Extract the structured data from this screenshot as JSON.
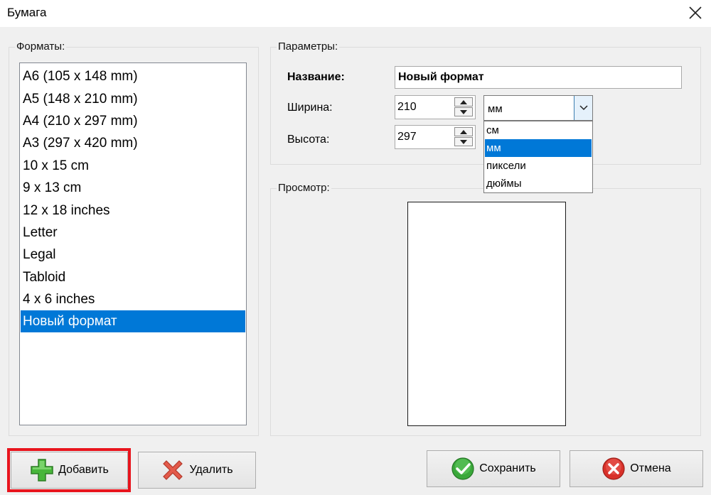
{
  "window": {
    "title": "Бумага"
  },
  "formats": {
    "legend": "Форматы:",
    "items": [
      "A6 (105 x 148 mm)",
      "A5 (148 x 210 mm)",
      "A4 (210 x 297 mm)",
      "A3 (297 x 420 mm)",
      "10 x 15 cm",
      "9 x 13 cm",
      "12 x 18 inches",
      "Letter",
      "Legal",
      "Tabloid",
      "4 x 6 inches",
      "Новый формат"
    ],
    "selected_index": 11
  },
  "params": {
    "legend": "Параметры:",
    "name_label": "Название:",
    "name_value": "Новый формат",
    "width_label": "Ширина:",
    "width_value": "210",
    "height_label": "Высота:",
    "height_value": "297",
    "unit_selected": "мм",
    "unit_options": [
      "см",
      "мм",
      "пиксели",
      "дюймы"
    ],
    "unit_highlight_index": 1
  },
  "preview": {
    "legend": "Просмотр:"
  },
  "buttons": {
    "add": "Добавить",
    "delete": "Удалить",
    "save": "Сохранить",
    "cancel": "Отмена"
  },
  "colors": {
    "selection": "#0078d7",
    "highlight_border": "#e8141d",
    "add_icon": "#48b63a",
    "delete_icon": "#e35a4a",
    "save_icon": "#3aa83a",
    "cancel_icon": "#d8312a"
  },
  "icons": {
    "close": "close-icon",
    "add": "plus-icon",
    "delete": "cross-icon",
    "save": "checkmark-icon",
    "cancel": "cancel-icon",
    "spin_up": "arrow-up-icon",
    "spin_down": "arrow-down-icon",
    "combo": "chevron-down-icon"
  }
}
